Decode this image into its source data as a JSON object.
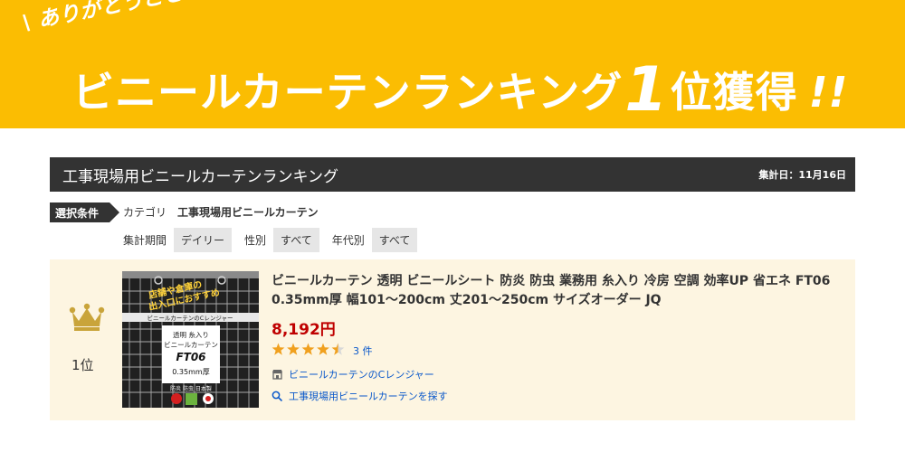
{
  "banner": {
    "thanks": "ありがとうございます",
    "headline_main": "ビニールカーテンランキング",
    "headline_num": "1",
    "headline_rank": "位獲得",
    "headline_excl": "!!"
  },
  "ranking": {
    "title": "工事現場用ビニールカーテンランキング",
    "date": "集計日：11月16日"
  },
  "conditions": {
    "tag": "選択条件",
    "category_label": "カテゴリ",
    "category_value": "工事現場用ビニールカーテン",
    "period_label": "集計期間",
    "period_value": "デイリー",
    "gender_label": "性別",
    "gender_value": "すべて",
    "age_label": "年代別",
    "age_value": "すべて"
  },
  "item": {
    "rank": "1位",
    "name": "ビニールカーテン 透明 ビニールシート 防炎 防虫 業務用 糸入り 冷房 空調 効率UP 省エネ FT06 0.35mm厚 幅101～200cm 丈201～250cm サイズオーダー JQ",
    "price": "8,192円",
    "stars": "★★★★★",
    "rating": 4.5,
    "review_count": "3 件",
    "shop": "ビニールカーテンのCレンジャー",
    "search": "工事現場用ビニールカーテンを探す",
    "image": {
      "top_text_1": "店舗や倉庫の",
      "top_text_2": "出入口におすすめ",
      "band": "ビニールカーテンのCレンジャー",
      "label_1": "透明 糸入り",
      "label_2": "ビニールカーテン",
      "model": "FT06",
      "thickness": "0.35mm厚",
      "badge": "防炎 防虫 日本製"
    }
  },
  "colors": {
    "banner": "#fbbd02",
    "header": "#333333",
    "price": "#bf0000",
    "link": "#0a58ca",
    "star": "#f0a01e",
    "card": "#fdf5e1",
    "crown": "#c9a43a"
  }
}
